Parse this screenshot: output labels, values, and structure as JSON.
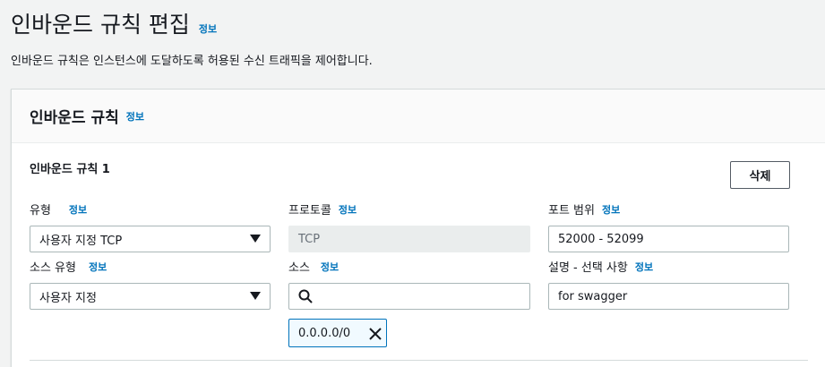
{
  "page": {
    "title": "인바운드 규칙 편집",
    "info_label": "정보",
    "description": "인바운드 규칙은 인스턴스에 도달하도록 허용된 수신 트래픽을 제어합니다."
  },
  "panel": {
    "title": "인바운드 규칙",
    "info_label": "정보"
  },
  "rule": {
    "title": "인바운드 규칙 1",
    "delete_label": "삭제",
    "type": {
      "label": "유형",
      "info": "정보",
      "value": "사용자 지정 TCP"
    },
    "protocol": {
      "label": "프로토콜",
      "info": "정보",
      "value": "TCP"
    },
    "port_range": {
      "label": "포트 범위",
      "info": "정보",
      "value": "52000 - 52099"
    },
    "source_type": {
      "label": "소스 유형",
      "info": "정보",
      "value": "사용자 지정"
    },
    "source": {
      "label": "소스",
      "info": "정보",
      "search_value": "",
      "token": "0.0.0.0/0"
    },
    "description": {
      "label": "설명 - 선택 사항",
      "info": "정보",
      "value": "for swagger"
    }
  },
  "colors": {
    "link": "#0073bb",
    "background": "#f2f3f3",
    "border": "#aab7b8"
  },
  "icons": [
    "caret-down-icon",
    "search-icon",
    "close-icon"
  ]
}
